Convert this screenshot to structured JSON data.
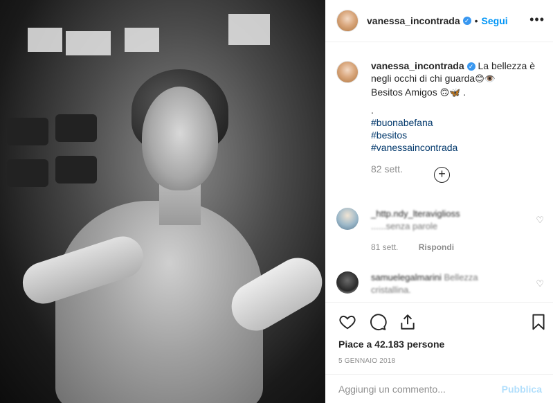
{
  "post": {
    "photo_icon": "portrait-photo",
    "author": {
      "username": "vanessa_incontrada",
      "verified_icon": "verified-badge-icon",
      "follow_label": "Segui",
      "separator": "•",
      "more_icon": "more-options-icon",
      "more_glyph": "•••"
    },
    "caption": {
      "username": "vanessa_incontrada",
      "text_line1": "La bellezza è negli occhi di chi guarda",
      "emoji1": "😊👁️",
      "text_line2": "Besitos Amigos",
      "emoji2": "🙃🦋",
      "period": " .",
      "dot": ".",
      "hashtags": [
        "#buonabefana",
        "#besitos",
        "#vanessaincontrada"
      ],
      "age": "82 sett."
    },
    "load_more_glyph": "+",
    "comments": [
      {
        "username": "_http.ndy_lteraviglioss",
        "text": "......senza parole",
        "age": "81 sett.",
        "reply_label": "Rispondi"
      },
      {
        "username": "samuelegalmarini",
        "text": "Bellezza cristallina.",
        "age": "",
        "reply_label": ""
      }
    ],
    "likes_text": "Piace a 42.183 persone",
    "date": "5 GENNAIO 2018",
    "comment_placeholder": "Aggiungi un commento...",
    "publish_label": "Pubblica",
    "colors": {
      "accent": "#0095f6",
      "verified": "#3897f0",
      "muted": "#8e8e8e",
      "publish_disabled": "#b2dffc"
    }
  }
}
